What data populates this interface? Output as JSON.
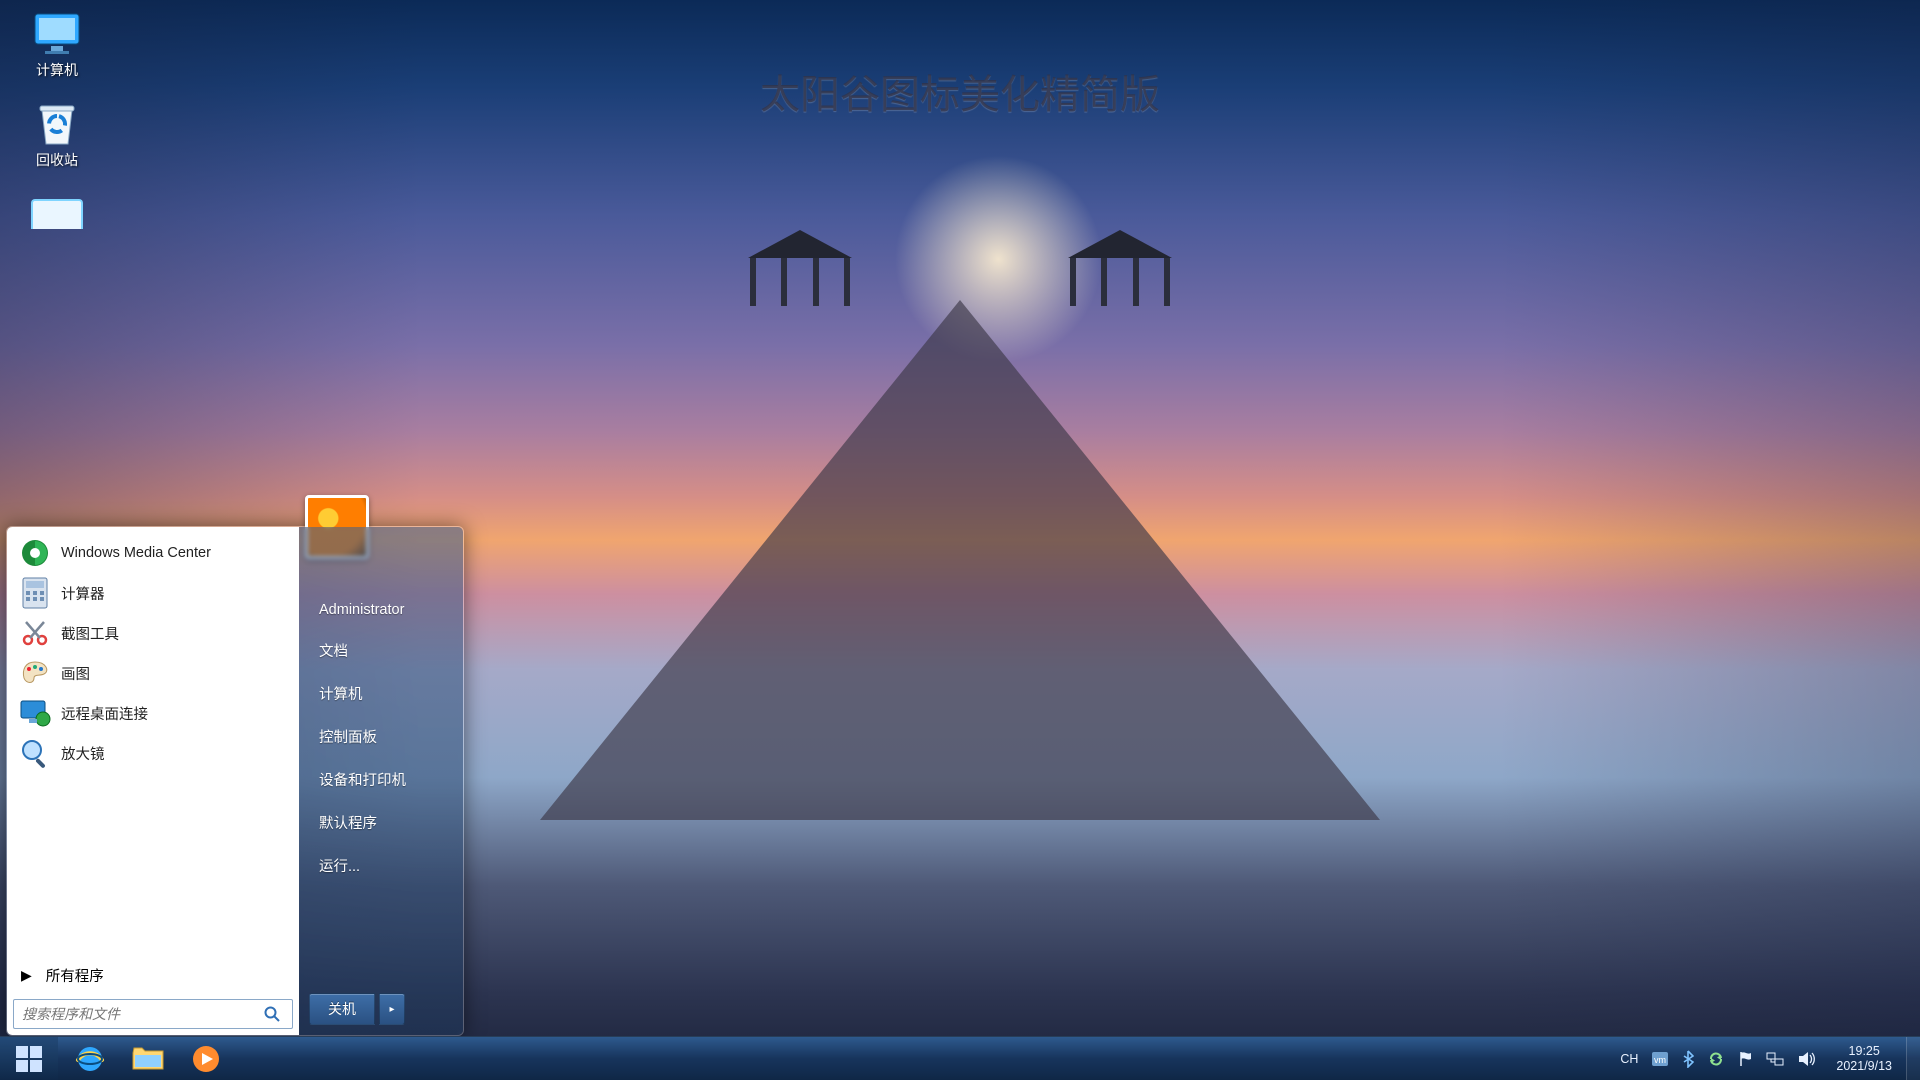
{
  "wallpaper": {
    "watermark": "太阳谷图标美化精简版"
  },
  "desktop": {
    "icons": [
      {
        "id": "computer",
        "label": "计算机"
      },
      {
        "id": "recycle",
        "label": "回收站"
      },
      {
        "id": "cpanel",
        "label": ""
      }
    ]
  },
  "startmenu": {
    "programs": [
      {
        "id": "wmc",
        "label": "Windows Media Center",
        "icon": "wmc-icon"
      },
      {
        "id": "calc",
        "label": "计算器",
        "icon": "calculator-icon"
      },
      {
        "id": "snip",
        "label": "截图工具",
        "icon": "scissors-icon"
      },
      {
        "id": "paint",
        "label": "画图",
        "icon": "palette-icon"
      },
      {
        "id": "rdp",
        "label": "远程桌面连接",
        "icon": "remote-desktop-icon"
      },
      {
        "id": "magnifier",
        "label": "放大镜",
        "icon": "magnifier-icon"
      }
    ],
    "all_programs": "所有程序",
    "search_placeholder": "搜索程序和文件",
    "user": "Administrator",
    "right_items": [
      "文档",
      "计算机",
      "控制面板",
      "设备和打印机",
      "默认程序",
      "运行..."
    ],
    "shutdown": "关机"
  },
  "taskbar": {
    "pinned": [
      {
        "id": "ie",
        "icon": "ie-icon"
      },
      {
        "id": "explorer",
        "icon": "folder-icon"
      },
      {
        "id": "wmplayer",
        "icon": "media-player-icon"
      }
    ],
    "tray": {
      "ime": "CH",
      "icons": [
        "vm-icon",
        "bluetooth-icon",
        "sync-icon",
        "flag-icon",
        "network-icon",
        "volume-icon"
      ]
    },
    "clock": {
      "time": "19:25",
      "date": "2021/9/13"
    }
  }
}
